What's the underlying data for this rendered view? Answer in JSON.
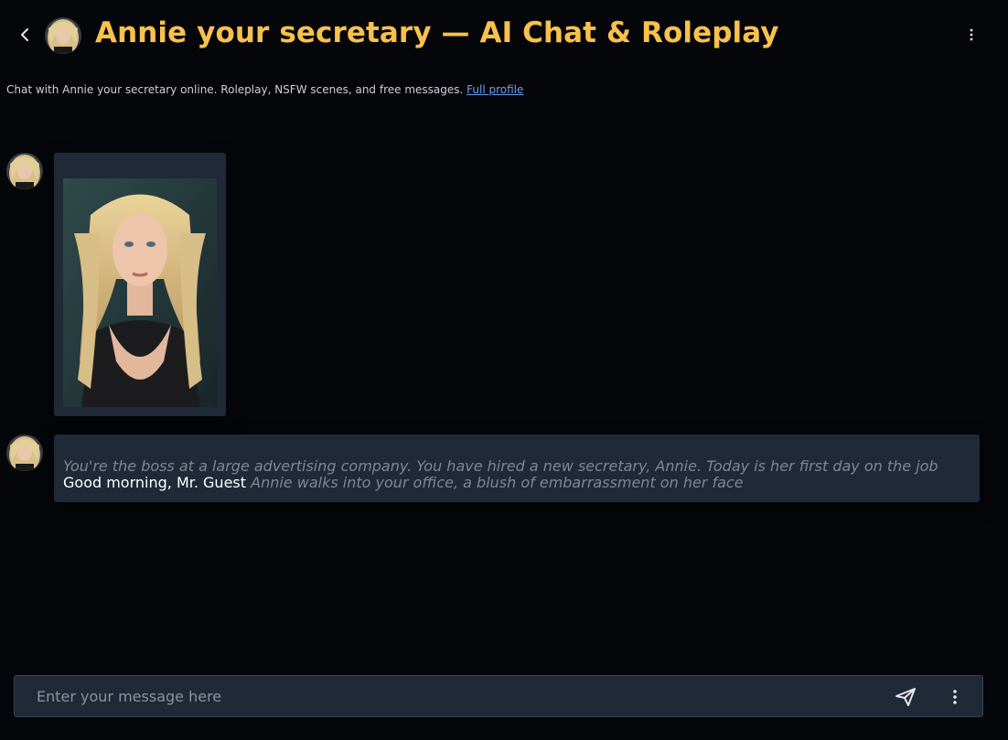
{
  "header": {
    "title": "Annie your secretary — AI Chat & Roleplay",
    "back_icon": "chevron-left-icon",
    "menu_icon": "vertical-dots-icon",
    "title_color": "#f7c14b"
  },
  "subtitle": {
    "text": "Chat with Annie your secretary online. Roleplay, NSFW scenes, and free messages. ",
    "link_label": "Full profile",
    "link_color": "#6b9cf5"
  },
  "messages": [
    {
      "type": "image",
      "sender": "Annie",
      "image_desc": "portrait-photo"
    },
    {
      "type": "text",
      "sender": "Annie",
      "narration_1": "You're the boss at a large advertising company. You have hired a new secretary, Annie. Today is her first day on the job",
      "speech": "Good morning, Mr. Guest",
      "narration_2": "Annie walks into your office, a blush of embarrassment on her face"
    }
  ],
  "composer": {
    "placeholder": "Enter your message here",
    "value": "",
    "send_icon": "paper-plane-icon",
    "menu_icon": "vertical-dots-icon"
  },
  "colors": {
    "background": "#05060a",
    "bubble": "#1f2937",
    "accent": "#f59e0b"
  }
}
